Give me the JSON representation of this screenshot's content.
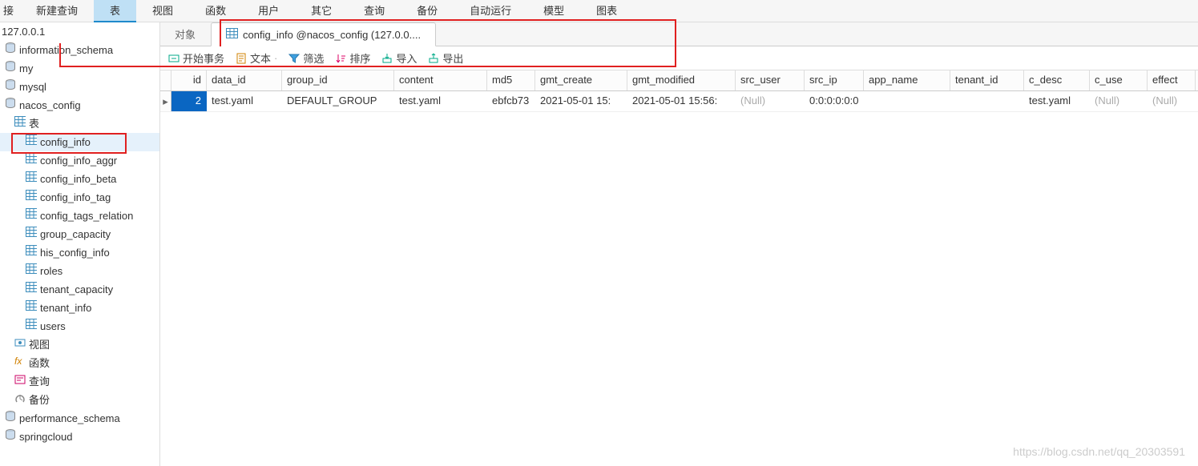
{
  "menubar": [
    {
      "label": "接",
      "active": false
    },
    {
      "label": "新建查询",
      "active": false
    },
    {
      "label": "表",
      "active": true
    },
    {
      "label": "视图",
      "active": false
    },
    {
      "label": "函数",
      "active": false
    },
    {
      "label": "用户",
      "active": false
    },
    {
      "label": "其它",
      "active": false
    },
    {
      "label": "查询",
      "active": false
    },
    {
      "label": "备份",
      "active": false
    },
    {
      "label": "自动运行",
      "active": false
    },
    {
      "label": "模型",
      "active": false
    },
    {
      "label": "图表",
      "active": false
    }
  ],
  "tree": {
    "top": "127.0.0.1",
    "databases": [
      {
        "name": "information_schema"
      },
      {
        "name": "my"
      },
      {
        "name": "mysql"
      },
      {
        "name": "nacos_config",
        "expanded": true
      }
    ],
    "nacos_groups": {
      "tables_label": "表",
      "tables": [
        {
          "name": "config_info",
          "selected": true
        },
        {
          "name": "config_info_aggr"
        },
        {
          "name": "config_info_beta"
        },
        {
          "name": "config_info_tag"
        },
        {
          "name": "config_tags_relation"
        },
        {
          "name": "group_capacity"
        },
        {
          "name": "his_config_info"
        },
        {
          "name": "roles"
        },
        {
          "name": "tenant_capacity"
        },
        {
          "name": "tenant_info"
        },
        {
          "name": "users"
        }
      ],
      "views_label": "视图",
      "functions_label": "函数",
      "queries_label": "查询",
      "backup_label": "备份"
    },
    "other_databases": [
      {
        "name": "performance_schema"
      },
      {
        "name": "springcloud"
      }
    ]
  },
  "tabs": {
    "objects": "对象",
    "active": "config_info @nacos_config (127.0.0...."
  },
  "toolbar": {
    "start_transaction": "开始事务",
    "text": "文本",
    "filter": "筛选",
    "sort": "排序",
    "import": "导入",
    "export": "导出"
  },
  "grid": {
    "columns": [
      "id",
      "data_id",
      "group_id",
      "content",
      "md5",
      "gmt_create",
      "gmt_modified",
      "src_user",
      "src_ip",
      "app_name",
      "tenant_id",
      "c_desc",
      "c_use",
      "effect"
    ],
    "row": {
      "id": "2",
      "data_id": "test.yaml",
      "group_id": "DEFAULT_GROUP",
      "content": "test.yaml",
      "md5": "ebfcb73",
      "gmt_create": "2021-05-01 15:",
      "gmt_modified": "2021-05-01 15:56:",
      "src_user": "(Null)",
      "src_ip": "0:0:0:0:0:0",
      "app_name": "",
      "tenant_id": "",
      "c_desc": "test.yaml",
      "c_use": "(Null)",
      "effect": "(Null)"
    }
  },
  "watermark": "https://blog.csdn.net/qq_20303591"
}
